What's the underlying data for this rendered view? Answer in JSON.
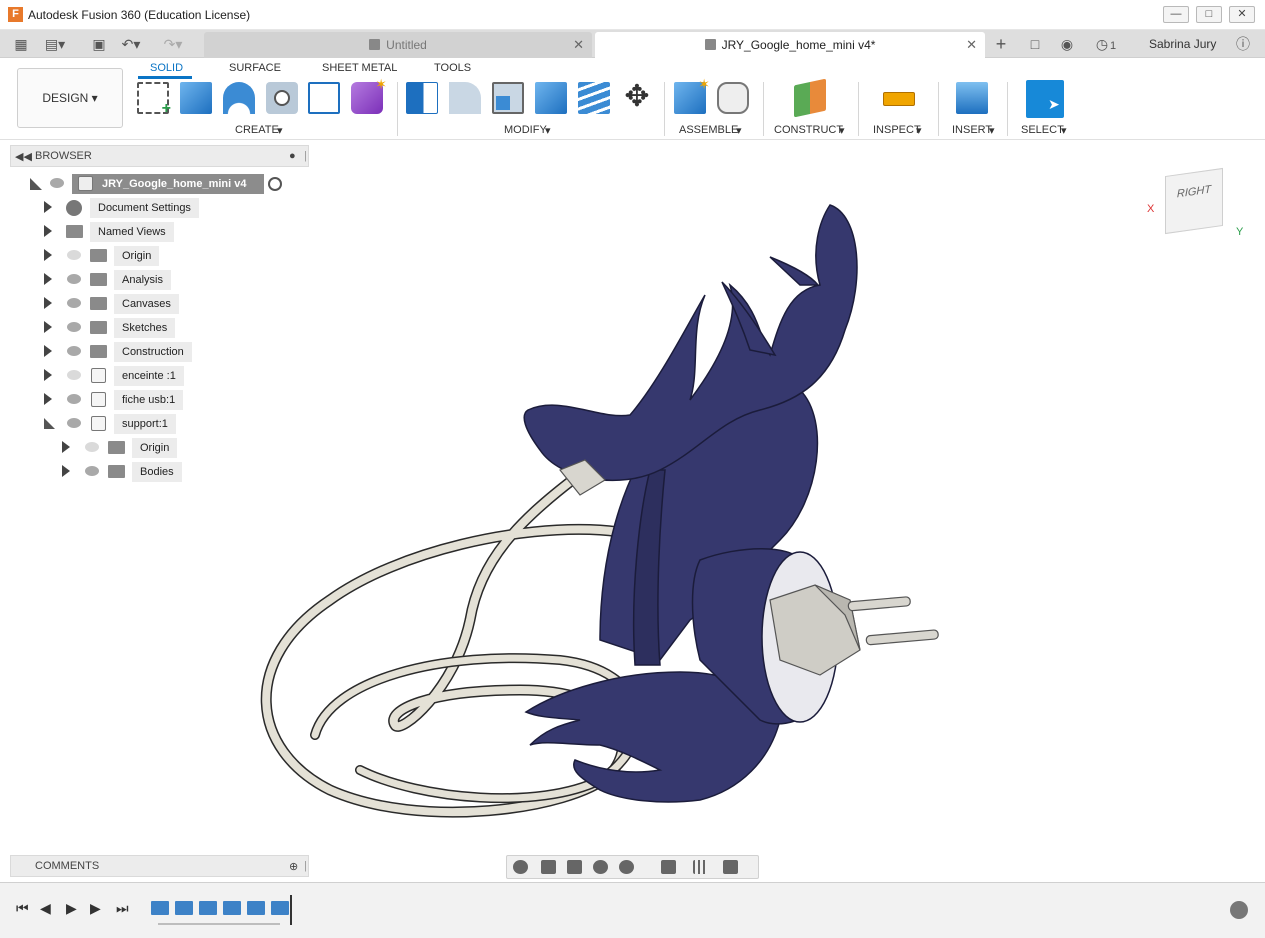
{
  "window": {
    "title": "Autodesk Fusion 360 (Education License)",
    "logo": "F",
    "minimize_icon": "minimize-icon",
    "maximize_icon": "maximize-icon",
    "close_icon": "close-icon"
  },
  "tabs": [
    {
      "label": "Untitled",
      "active": false
    },
    {
      "label": "JRY_Google_home_mini v4*",
      "active": true
    }
  ],
  "header": {
    "notification_count": "1",
    "user": "Sabrina Jury"
  },
  "toolbar": {
    "workspace": "DESIGN",
    "workspace_tabs": [
      "SOLID",
      "SURFACE",
      "SHEET METAL",
      "TOOLS"
    ],
    "groups": [
      "CREATE",
      "MODIFY",
      "ASSEMBLE",
      "CONSTRUCT",
      "INSPECT",
      "INSERT",
      "SELECT"
    ]
  },
  "browser": {
    "title": "BROWSER",
    "root": "JRY_Google_home_mini v4",
    "items": [
      {
        "label": "Document Settings",
        "icon": "gear-icon",
        "visible": null,
        "level": 1
      },
      {
        "label": "Named Views",
        "icon": "folder-icon",
        "visible": null,
        "level": 1
      },
      {
        "label": "Origin",
        "icon": "folder-icon",
        "visible": false,
        "level": 1
      },
      {
        "label": "Analysis",
        "icon": "folder-icon",
        "visible": true,
        "level": 1
      },
      {
        "label": "Canvases",
        "icon": "folder-icon",
        "visible": true,
        "level": 1
      },
      {
        "label": "Sketches",
        "icon": "folder-icon",
        "visible": true,
        "level": 1
      },
      {
        "label": "Construction",
        "icon": "folder-icon",
        "visible": true,
        "level": 1
      },
      {
        "label": "enceinte :1",
        "icon": "component-icon",
        "visible": false,
        "level": 1
      },
      {
        "label": "fiche usb:1",
        "icon": "component-icon",
        "visible": true,
        "level": 1
      },
      {
        "label": "support:1",
        "icon": "component-icon",
        "visible": true,
        "level": 1,
        "expanded": true
      },
      {
        "label": "Origin",
        "icon": "folder-icon",
        "visible": false,
        "level": 2
      },
      {
        "label": "Bodies",
        "icon": "folder-icon",
        "visible": true,
        "level": 2
      }
    ]
  },
  "comments": {
    "title": "COMMENTS"
  },
  "viewcube": {
    "face": "RIGHT",
    "axis_x": "X",
    "axis_y": "Y"
  },
  "colors": {
    "accent": "#0a74c5",
    "model": "#36386e",
    "cable": "#e4e1d6"
  }
}
